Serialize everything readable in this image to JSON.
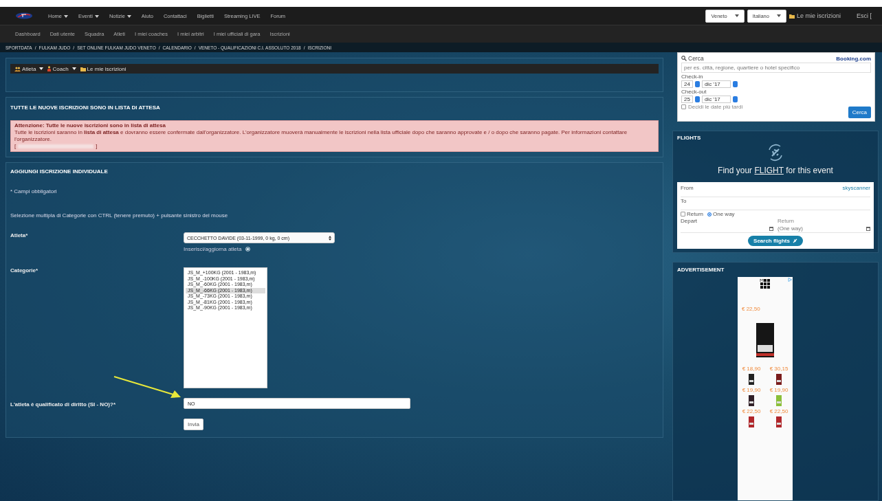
{
  "top_nav": {
    "items": [
      {
        "label": "Home",
        "dropdown": true
      },
      {
        "label": "Eventi",
        "dropdown": true
      },
      {
        "label": "Notizie",
        "dropdown": true
      },
      {
        "label": "Aiuto",
        "dropdown": false
      },
      {
        "label": "Contattaci",
        "dropdown": false
      },
      {
        "label": "Biglietti",
        "dropdown": false
      },
      {
        "label": "Streaming LIVE",
        "dropdown": false
      },
      {
        "label": "Forum",
        "dropdown": false
      }
    ],
    "region": "Veneto",
    "language": "Italiano",
    "my_registrations": "Le mie iscrizioni",
    "logout": "Esci ["
  },
  "sub_nav": [
    "Dashboard",
    "Dati utente",
    "Squadra",
    "Atleti",
    "I miei coaches",
    "I miei arbitri",
    "I miei ufficiali di gara",
    "Iscrizioni"
  ],
  "breadcrumb": {
    "separator": "/",
    "items": [
      "SPORTDATA",
      "FULKAM JUDO",
      "SET ONLINE FULKAM JUDO VENETO",
      "CALENDARIO",
      "VENETO - QUALIFICAZIONI C.I. ASSOLUTO 2018",
      "ISCRIZIONI"
    ]
  },
  "toolbar": [
    {
      "label": "Atleta",
      "kind": "athletes",
      "dropdown": true
    },
    {
      "label": "Coach",
      "kind": "coach",
      "dropdown": true
    },
    {
      "label": "Le mie iscrizioni",
      "kind": "registrations",
      "dropdown": false
    }
  ],
  "notice": {
    "title": "TUTTE LE NUOVE ISCRIZIONI SONO IN LISTA DI ATTESA",
    "alert_title": "Attenzione: Tutte le nuove iscrizioni sono in lista di attesa",
    "alert_text": "Tutte le iscrizioni saranno in **lista di attesa** e dovranno essere confermate dall'organizzatore. L'organizzatore muoverà manualmente le iscrizioni nella lista ufficiale dopo che saranno approvate e / o dopo che saranno pagate. Per informazioni contattare l'organizzatore.",
    "bracket_open": "[",
    "bracket_close": "]"
  },
  "form": {
    "title": "AGGIUNGI ISCRIZIONE INDIVIDUALE",
    "required_note": "* Campi obbligatori",
    "multi_select_hint": "Selezione multipla di Categorie con CTRL (tenere premuto) + pulsante sinistro del mouse",
    "athlete_label": "Atleta*",
    "athlete_value": "CECCHETTO DAVIDE (03-11-1999, 0 kg, 0 cm)",
    "athlete_link": "Inserisci/aggiorna atleta",
    "categories_label": "Categorie*",
    "categories": [
      {
        "label": "JS_M_+100KG (2001 - 1983,m)",
        "selected": false
      },
      {
        "label": "JS_M_-100KG (2001 - 1983,m)",
        "selected": false
      },
      {
        "label": "JS_M_-60KG (2001 - 1983,m)",
        "selected": false
      },
      {
        "label": "JS_M_-66KG (2001 - 1983,m)",
        "selected": true
      },
      {
        "label": "JS_M_-73KG (2001 - 1983,m)",
        "selected": false
      },
      {
        "label": "JS_M_-81KG (2001 - 1983,m)",
        "selected": false
      },
      {
        "label": "JS_M_-90KG (2001 - 1983,m)",
        "selected": false
      }
    ],
    "qualified_label": "L'atleta è qualificato di diritto (SI - NO)?*",
    "qualified_value": "NO",
    "submit": "Invia"
  },
  "booking": {
    "search_label": "Cerca",
    "brand": "Booking.com",
    "destination_placeholder": "per es. città, regione, quartiere o hotel specifico",
    "dates": [
      {
        "label": "Check-in",
        "day": "24",
        "month": "dic '17"
      },
      {
        "label": "Check-out",
        "day": "25",
        "month": "dic '17"
      }
    ],
    "decide_later": {
      "label": "Decidi le date più tardi",
      "checked": false
    },
    "button": "Cerca"
  },
  "flights": {
    "title": "FLIGHTS",
    "headline_before": "Find your",
    "headline_link": "FLIGHT",
    "headline_after": "for this event",
    "from_label": "From",
    "brand": "skyscanner",
    "to_label": "To",
    "trip_options": [
      {
        "label": "Return",
        "kind": "checkbox",
        "selected": false
      },
      {
        "label": "One way",
        "kind": "radio",
        "selected": true
      }
    ],
    "depart_label": "Depart",
    "return_label": "Return",
    "return_placeholder": "(One way)",
    "button": "Search flights"
  },
  "advertisement": {
    "title": "ADVERTISEMENT",
    "featured_price": "€ 22,50",
    "prices": [
      "€ 18,90",
      "€ 30,15",
      "€ 19,90",
      "€ 19,90",
      "€ 22,50",
      "€ 22,50"
    ]
  }
}
